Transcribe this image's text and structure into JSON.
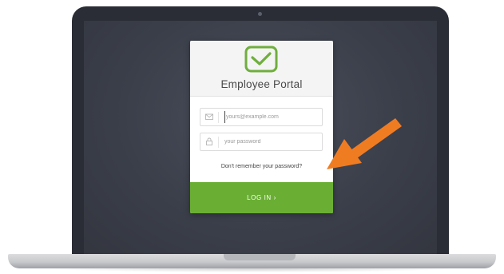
{
  "portal": {
    "title": "Employee Portal"
  },
  "login_form": {
    "email_placeholder": "yours@example.com",
    "password_placeholder": "your password",
    "forgot_link": "Don't remember your password?",
    "login_button": "LOG IN ›"
  },
  "icons": {
    "logo": "envelope-check-icon",
    "email": "mail-icon",
    "password": "lock-icon",
    "annotation": "arrow-pointer-icon"
  },
  "colors": {
    "brand_green": "#6aaf34",
    "logo_green": "#6fae3d",
    "arrow_orange": "#f07c22",
    "screen_bg": "#3b3f4a",
    "bezel": "#2a2d35"
  }
}
